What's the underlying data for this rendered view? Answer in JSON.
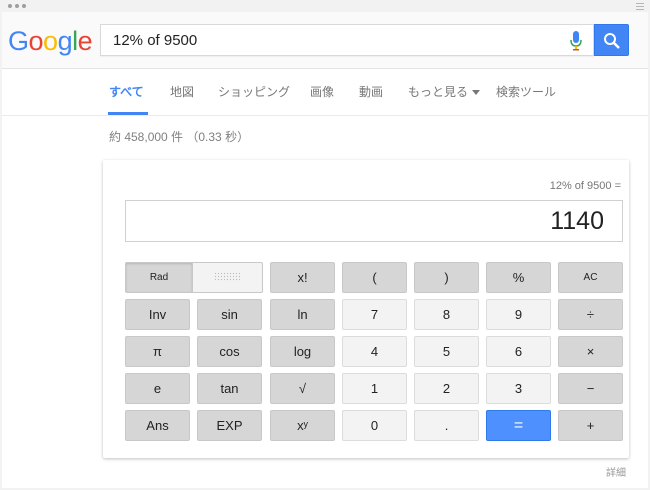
{
  "logo": {
    "text": "Google",
    "letters": [
      {
        "ch": "G",
        "color": "#4285f4"
      },
      {
        "ch": "o",
        "color": "#ea4335"
      },
      {
        "ch": "o",
        "color": "#fbbc05"
      },
      {
        "ch": "g",
        "color": "#4285f4"
      },
      {
        "ch": "l",
        "color": "#34a853"
      },
      {
        "ch": "e",
        "color": "#ea4335"
      }
    ]
  },
  "search": {
    "query": "12% of 9500"
  },
  "tabs": [
    {
      "label": "すべて",
      "active": true
    },
    {
      "label": "地図"
    },
    {
      "label": "ショッピング"
    },
    {
      "label": "画像"
    },
    {
      "label": "動画"
    },
    {
      "label": "もっと見る"
    },
    {
      "label": "検索ツール"
    }
  ],
  "result_stats": "約 458,000 件 （0.33 秒）",
  "calculator": {
    "expression": "12% of 9500 =",
    "result": "1140",
    "rad_label": "Rad",
    "keys": {
      "fact": "x!",
      "lparen": "(",
      "rparen": ")",
      "percent": "%",
      "ac": "AC",
      "inv": "Inv",
      "sin": "sin",
      "ln": "ln",
      "n7": "7",
      "n8": "8",
      "n9": "9",
      "divide": "÷",
      "pi": "π",
      "cos": "cos",
      "log": "log",
      "n4": "4",
      "n5": "5",
      "n6": "6",
      "multiply": "×",
      "e": "e",
      "tan": "tan",
      "sqrt": "√",
      "n1": "1",
      "n2": "2",
      "n3": "3",
      "minus": "−",
      "ans": "Ans",
      "exp": "EXP",
      "pow": "xʸ",
      "n0": "0",
      "dot": ".",
      "equals": "=",
      "plus": "+"
    }
  },
  "footer": {
    "detail_link": "詳細"
  },
  "colors": {
    "accent": "#4285f4"
  }
}
